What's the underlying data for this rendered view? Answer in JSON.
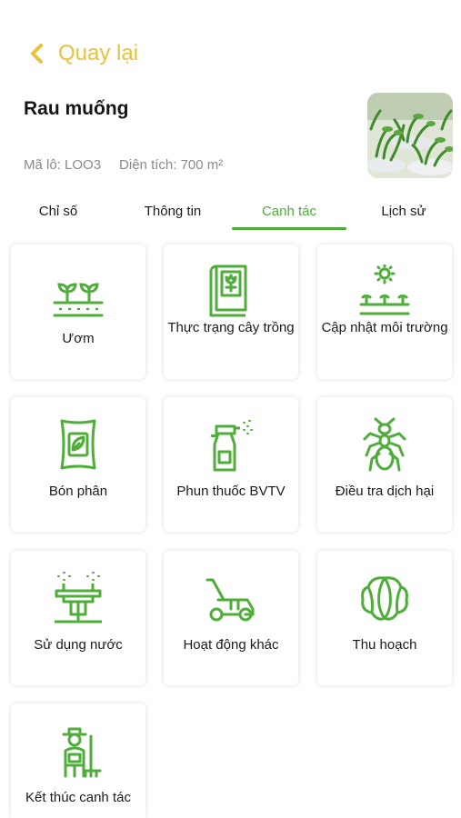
{
  "header": {
    "back_label": "Quay lại",
    "title": "Rau muống",
    "lot_code": "Mã lô: LOO3",
    "area": "Diện tích: 700 m²"
  },
  "tabs": [
    {
      "label": "Chỉ số",
      "active": false
    },
    {
      "label": "Thông tin",
      "active": false
    },
    {
      "label": "Canh tác",
      "active": true
    },
    {
      "label": "Lịch sử",
      "active": false
    }
  ],
  "actions": [
    {
      "label": "Ươm",
      "icon": "seedling-bed-icon"
    },
    {
      "label": "Thực trạng cây trồng",
      "icon": "plant-book-icon"
    },
    {
      "label": "Cập nhật môi trường",
      "icon": "sun-sprouts-icon"
    },
    {
      "label": "Bón phân",
      "icon": "fertilizer-bag-icon"
    },
    {
      "label": "Phun thuốc BVTV",
      "icon": "spray-bottle-icon"
    },
    {
      "label": "Điều tra dịch hại",
      "icon": "ant-icon"
    },
    {
      "label": "Sử dụng nước",
      "icon": "sprinkler-icon"
    },
    {
      "label": "Hoạt động khác",
      "icon": "lawn-mower-icon"
    },
    {
      "label": "Thu hoạch",
      "icon": "cabbage-icon"
    },
    {
      "label": "Kết thúc canh tác",
      "icon": "farmer-icon"
    }
  ],
  "colors": {
    "accent_green": "#4fae3a",
    "back_yellow": "#e8c23d",
    "meta_gray": "#8a8a8a"
  }
}
